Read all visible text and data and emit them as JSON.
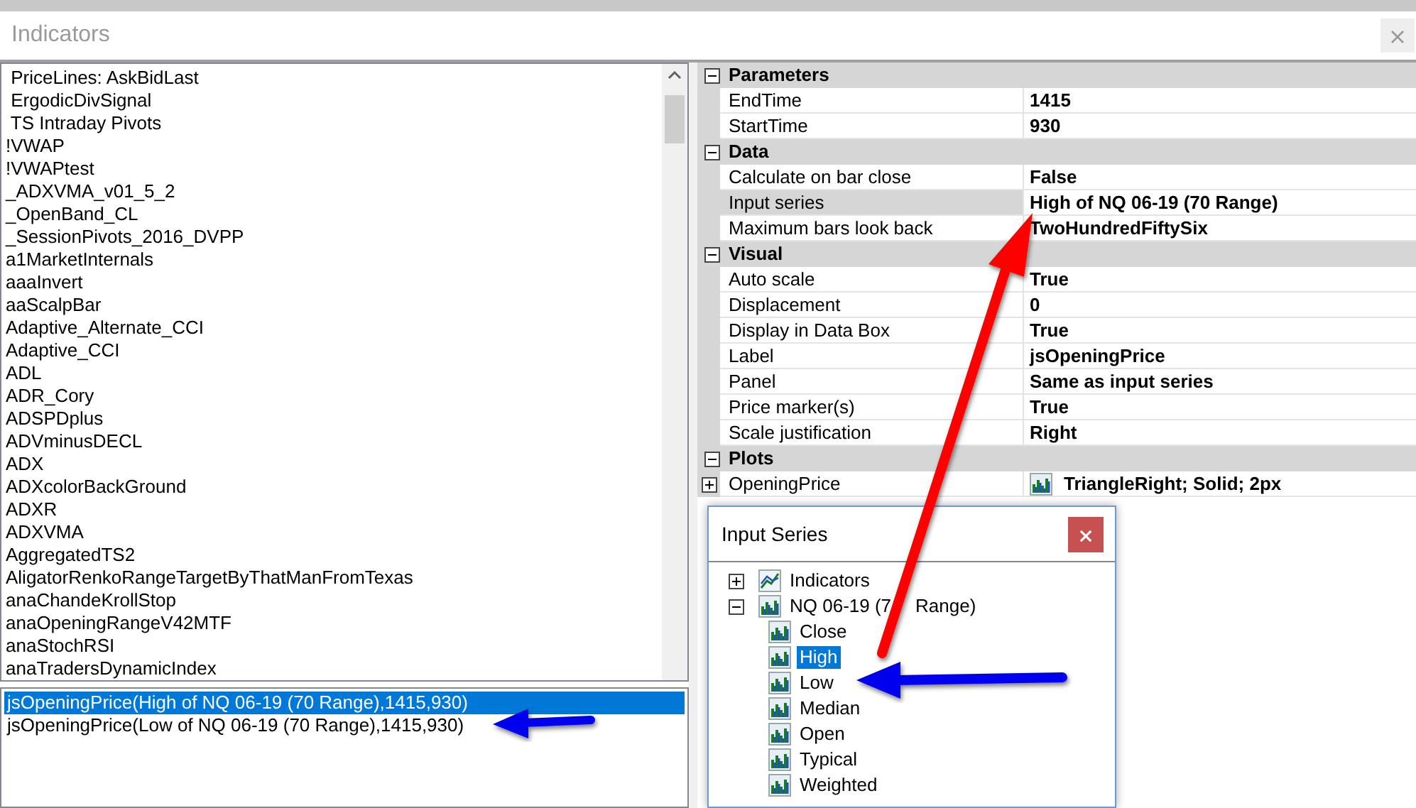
{
  "window": {
    "title": "Indicators"
  },
  "indicator_list": {
    "items": [
      {
        "label": " PriceLines: AskBidLast"
      },
      {
        "label": " ErgodicDivSignal"
      },
      {
        "label": " TS Intraday Pivots"
      },
      {
        "label": "!VWAP"
      },
      {
        "label": "!VWAPtest"
      },
      {
        "label": "_ADXVMA_v01_5_2"
      },
      {
        "label": "_OpenBand_CL"
      },
      {
        "label": "_SessionPivots_2016_DVPP"
      },
      {
        "label": "a1MarketInternals"
      },
      {
        "label": "aaaInvert"
      },
      {
        "label": "aaScalpBar"
      },
      {
        "label": "Adaptive_Alternate_CCI"
      },
      {
        "label": "Adaptive_CCI"
      },
      {
        "label": "ADL"
      },
      {
        "label": "ADR_Cory"
      },
      {
        "label": "ADSPDplus"
      },
      {
        "label": "ADVminusDECL"
      },
      {
        "label": "ADX"
      },
      {
        "label": "ADXcolorBackGround"
      },
      {
        "label": "ADXR"
      },
      {
        "label": "ADXVMA"
      },
      {
        "label": "AggregatedTS2"
      },
      {
        "label": "AligatorRenkoRangeTargetByThatManFromTexas"
      },
      {
        "label": "anaChandeKrollStop"
      },
      {
        "label": "anaOpeningRangeV42MTF"
      },
      {
        "label": "anaStochRSI"
      },
      {
        "label": "anaTradersDynamicIndex"
      }
    ]
  },
  "applied_list": {
    "items": [
      {
        "label": "jsOpeningPrice(High of NQ 06-19 (70 Range),1415,930)",
        "selected": true
      },
      {
        "label": "jsOpeningPrice(Low of NQ 06-19 (70 Range),1415,930)",
        "selected": false
      }
    ]
  },
  "property_grid": {
    "categories": [
      {
        "name": "Parameters",
        "expanded": true,
        "rows": [
          {
            "name": "EndTime",
            "value": "1415",
            "selected": false
          },
          {
            "name": "StartTime",
            "value": "930",
            "selected": false
          }
        ]
      },
      {
        "name": "Data",
        "expanded": true,
        "rows": [
          {
            "name": "Calculate on bar close",
            "value": "False",
            "selected": false
          },
          {
            "name": "Input series",
            "value": "High of NQ 06-19 (70 Range)",
            "selected": true
          },
          {
            "name": "Maximum bars look back",
            "value": "TwoHundredFiftySix",
            "selected": false
          }
        ]
      },
      {
        "name": "Visual",
        "expanded": true,
        "rows": [
          {
            "name": "Auto scale",
            "value": "True",
            "selected": false
          },
          {
            "name": "Displacement",
            "value": "0",
            "selected": false
          },
          {
            "name": "Display in Data Box",
            "value": "True",
            "selected": false
          },
          {
            "name": "Label",
            "value": "jsOpeningPrice",
            "selected": false
          },
          {
            "name": "Panel",
            "value": "Same as input series",
            "selected": false
          },
          {
            "name": "Price marker(s)",
            "value": "True",
            "selected": false
          },
          {
            "name": "Scale justification",
            "value": "Right",
            "selected": false
          }
        ]
      },
      {
        "name": "Plots",
        "expanded": true,
        "rows": [
          {
            "name": "OpeningPrice",
            "value": "TriangleRight; Solid; 2px",
            "selected": false,
            "expanded": false
          }
        ]
      }
    ]
  },
  "input_series_dialog": {
    "title": "Input Series",
    "tree": [
      {
        "label": "Indicators",
        "kind": "indicator",
        "expanded": false,
        "selected": false
      },
      {
        "label": "NQ 06-19 (7",
        "label_after_arrow": "Range)",
        "kind": "series",
        "expanded": true,
        "selected": false,
        "children": [
          {
            "label": "Close",
            "kind": "series",
            "selected": false
          },
          {
            "label": "High",
            "kind": "series",
            "selected": true
          },
          {
            "label": "Low",
            "kind": "series",
            "selected": false
          },
          {
            "label": "Median",
            "kind": "series",
            "selected": false
          },
          {
            "label": "Open",
            "kind": "series",
            "selected": false
          },
          {
            "label": "Typical",
            "kind": "series",
            "selected": false
          },
          {
            "label": "Weighted",
            "kind": "series",
            "selected": false
          }
        ]
      }
    ]
  }
}
